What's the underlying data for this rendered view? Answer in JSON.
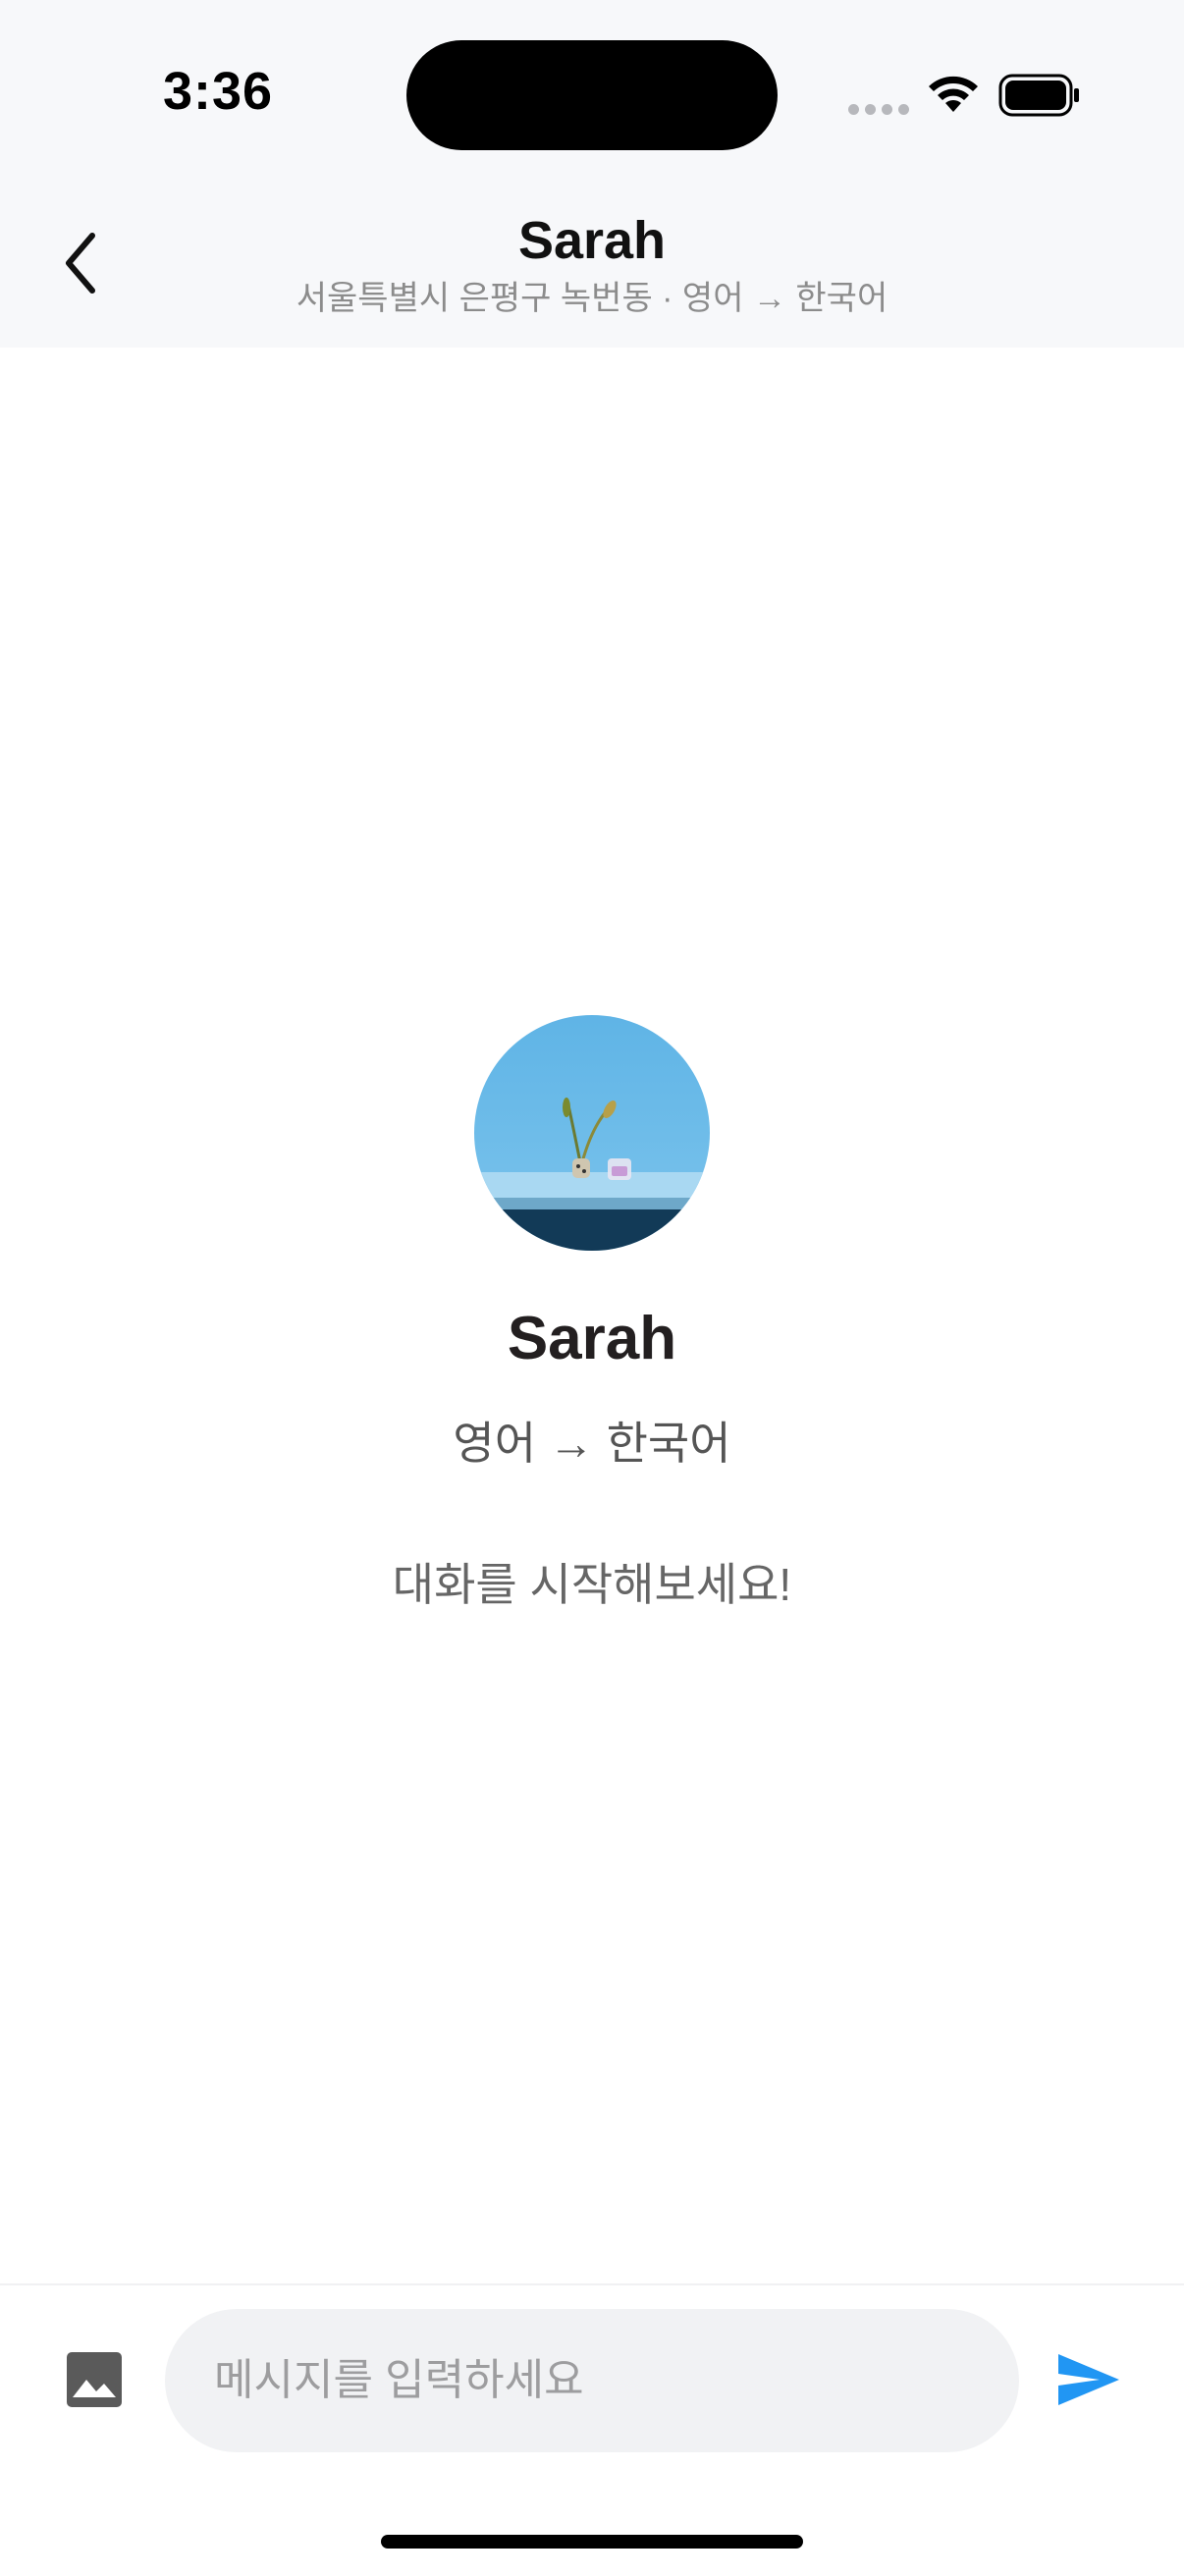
{
  "status_bar": {
    "time": "3:36"
  },
  "header": {
    "back_icon": "chevron-left-icon",
    "title": "Sarah",
    "subtitle": "서울특별시 은평구 녹번동 · 영어 → 한국어"
  },
  "profile": {
    "name": "Sarah",
    "languages": "영어 → 한국어",
    "empty_prompt": "대화를 시작해보세요!"
  },
  "composer": {
    "image_icon": "image-icon",
    "placeholder": "메시지를 입력하세요",
    "value": "",
    "send_icon": "send-icon",
    "accent_color": "#2196f3"
  },
  "colors": {
    "header_bg": "#f7f8fa",
    "background": "#ffffff"
  }
}
